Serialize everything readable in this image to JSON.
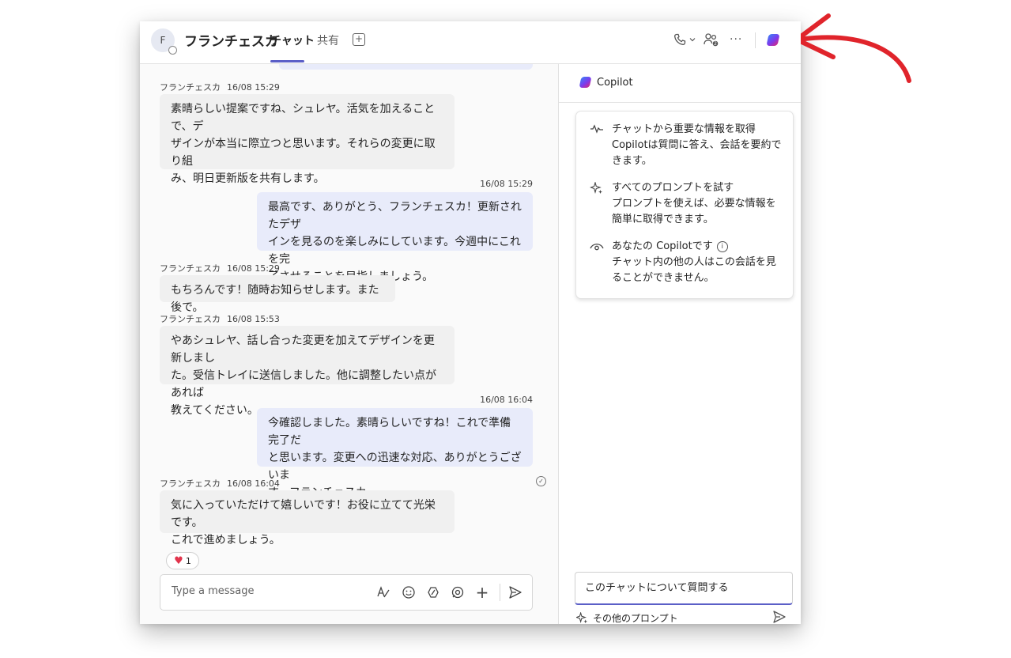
{
  "header": {
    "avatar_initial": "F",
    "title": "フランチェスカ",
    "tabs": [
      {
        "label": "チャット",
        "active": true
      },
      {
        "label": "共有",
        "active": false
      }
    ],
    "add_tab_symbol": "+",
    "more_symbol": "···"
  },
  "messages": [
    {
      "direction": "in",
      "sender": "フランチェスカ",
      "time": "16/08 15:29",
      "lines": [
        "素晴らしい提案ですね、シュレヤ。活気を加えることで、デ",
        "ザインが本当に際立つと思います。それらの変更に取り組",
        "み、明日更新版を共有します。"
      ]
    },
    {
      "direction": "out",
      "time": "16/08 15:29",
      "lines": [
        "最高です、ありがとう、フランチェスカ！更新されたデザ",
        "インを見るのを楽しみにしています。今週中にこれを完",
        "了させることを目指しましょう。"
      ]
    },
    {
      "direction": "in",
      "sender": "フランチェスカ",
      "time": "16/08 15:29",
      "lines": [
        "もちろんです！随時お知らせします。また後で。"
      ]
    },
    {
      "direction": "in",
      "sender": "フランチェスカ",
      "time": "16/08 15:53",
      "lines": [
        "やあシュレヤ、話し合った変更を加えてデザインを更新しまし",
        "た。受信トレイに送信しました。他に調整したい点があれば",
        "教えてください。"
      ]
    },
    {
      "direction": "out",
      "time": "16/08 16:04",
      "lines": [
        "今確認しました。素晴らしいですね！これで準備完了だ",
        "と思います。変更への迅速な対応、ありがとうございま",
        "す、フランチェスカ。"
      ]
    },
    {
      "direction": "in",
      "sender": "フランチェスカ",
      "time": "16/08 16:04",
      "lines": [
        "気に入っていただけて嬉しいです！お役に立てて光栄です。",
        "これで進めましょう。"
      ]
    }
  ],
  "reaction": {
    "icon": "heart-icon",
    "count": "1"
  },
  "composer": {
    "placeholder": "Type a message"
  },
  "copilot": {
    "title": "Copilot",
    "items": [
      {
        "icon": "summary-wave-icon",
        "title": "チャットから重要な情報を取得",
        "desc": "Copilotは質問に答え、会話を要約できます。"
      },
      {
        "icon": "sparkle-icon",
        "title": "すべてのプロンプトを試す",
        "desc": "プロンプトを使えば、必要な情報を簡単に取得できます。"
      },
      {
        "icon": "eye-icon",
        "title": "あなたの Copilotです",
        "desc": "チャット内の他の人はこの会話を見ることができません。"
      }
    ],
    "input_placeholder": "このチャットについて質問する",
    "more_prompts": "その他のプロンプト"
  },
  "colors": {
    "accent": "#5b5fc7",
    "outgoing_bubble": "#e8ebfa",
    "incoming_bubble": "#f0f0f0",
    "annotation_arrow": "#e0242b"
  }
}
